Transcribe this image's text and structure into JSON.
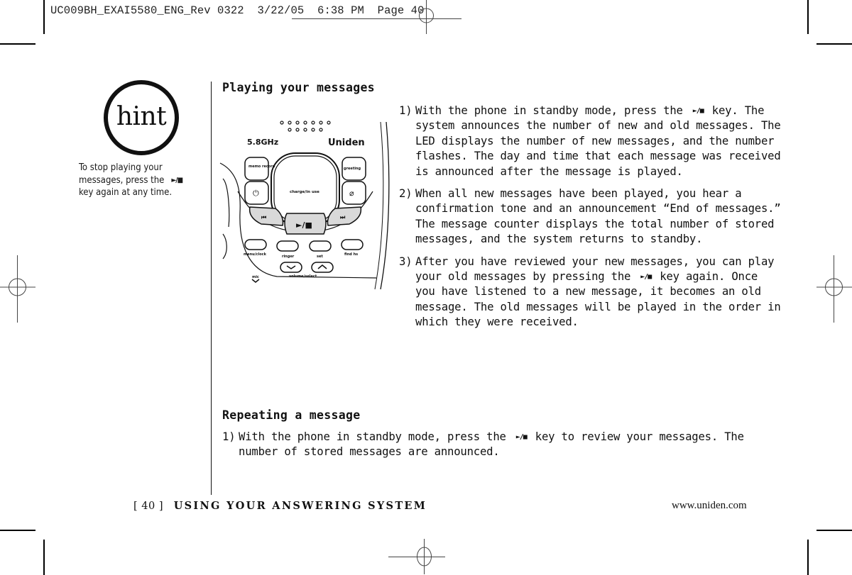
{
  "slug": {
    "text": "UC009BH_EXAI5580_ENG_Rev 0322  3/22/05  6:38 PM  Page 40"
  },
  "hint": {
    "badge": "hint",
    "text_before_icon": "To stop playing your messages, press the",
    "icon": "play-stop-icon",
    "icon_glyph": "►/■",
    "text_after_icon": "key again at any time."
  },
  "sections": {
    "playing": {
      "heading": "Playing your messages",
      "steps": [
        {
          "num": "1)",
          "before": "With the phone in standby mode, press the",
          "icon_glyph": "►/■",
          "after": "key. The system announces the number of new and old messages. The LED displays the number of new messages, and the number flashes. The day and time that each message was received is announced after the message is played."
        },
        {
          "num": "2)",
          "text": "When all new messages have been played, you hear a confirmation tone and an announcement “End of messages.” The message counter displays the total number of stored messages, and the system returns to standby."
        },
        {
          "num": "3)",
          "before": "After you have reviewed your new messages, you can play your old messages by pressing the",
          "icon_glyph": "►/■",
          "after": "key again. Once you have listened to a new message, it becomes an old message. The old messages will be played in the order in which they were received."
        }
      ]
    },
    "repeating": {
      "heading": "Repeating a message",
      "steps": [
        {
          "num": "1)",
          "before": "With the phone in standby mode, press the",
          "icon_glyph": "►/■",
          "after": "key to review your messages. The number of stored messages are announced."
        }
      ]
    }
  },
  "phone_illustration": {
    "brand": "Uniden",
    "band": "5.8GHz",
    "display_label": "charge/in use",
    "buttons": {
      "memo_record": "memo record",
      "greeting": "greeting",
      "power": "⏻",
      "delete": "⌀",
      "rewind": "⏮",
      "play_stop": "►/■",
      "skip": "⏭",
      "menu_clock": "menu/clock",
      "ringer": "ringer",
      "set": "set",
      "find_hs": "find hs",
      "volume_select": "volume/select",
      "mic": "mic"
    }
  },
  "footer": {
    "page": "[ 40 ]",
    "section_title": "USING YOUR ANSWERING SYSTEM",
    "url": "www.uniden.com"
  }
}
